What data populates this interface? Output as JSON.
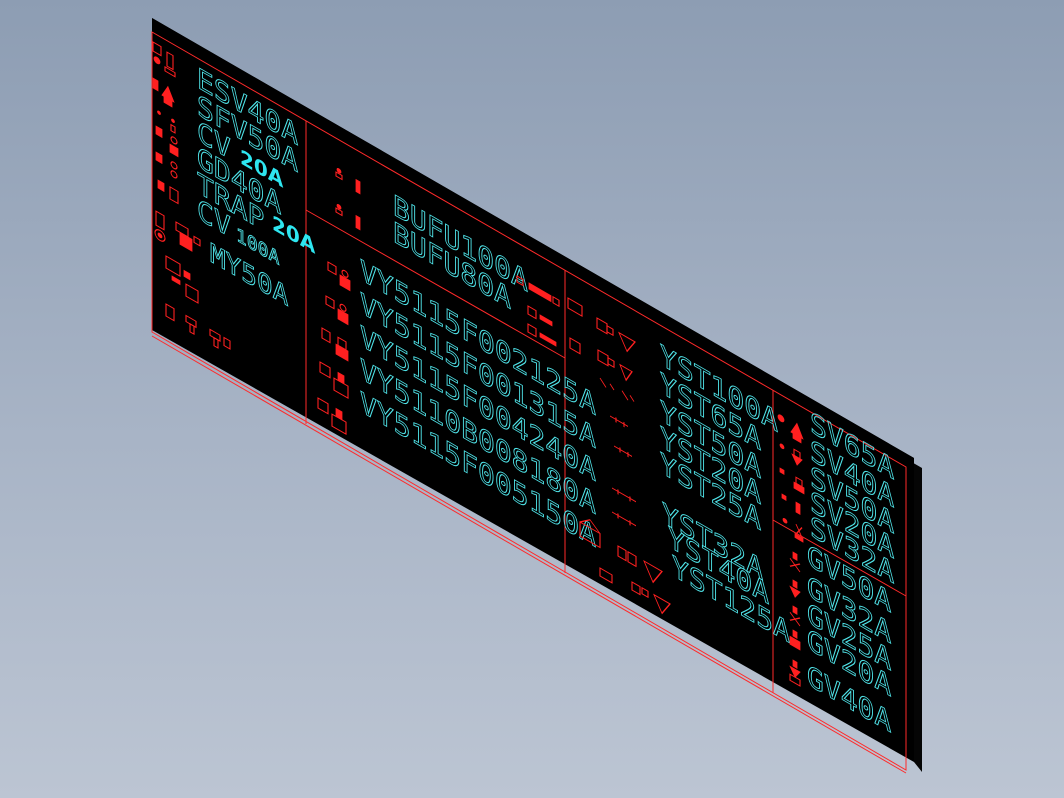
{
  "colors": {
    "board": "#000000",
    "board_edge": "#0a0a0a",
    "frame": "#ff2a2a",
    "label": "#4fe3e8",
    "symbol": "#ff2020",
    "background": "#a2afc2"
  },
  "panel1": {
    "labels": [
      "ESV40A",
      "SFV50A",
      "CV",
      "GD40A",
      "TRAP",
      "CV",
      "MY50A"
    ],
    "sub_labels": [
      "100A"
    ],
    "callouts": [
      "20A",
      "20A"
    ]
  },
  "panel2": {
    "labels": [
      "BUFU100A",
      "BUFU80A"
    ]
  },
  "panel3": {
    "labels": [
      "VY5115F002125A",
      "VY5115F001315A",
      "VY5115F004240A",
      "VY5110B008180A",
      "VY5115F005150A"
    ]
  },
  "panel4": {
    "labels": [
      "YST100A",
      "YST65A",
      "YST50A",
      "YST20A",
      "YST25A",
      "YST32A",
      "YST40A",
      "YST125A"
    ]
  },
  "panel5": {
    "labels": [
      "SV65A",
      "SV40A",
      "SV50A",
      "SV20A",
      "SV32A"
    ]
  },
  "panel6": {
    "labels": [
      "GV50A",
      "GV32A",
      "GV25A",
      "GV20A",
      "GV40A"
    ]
  },
  "symbols": {
    "panel1": "valve-symbol-icon",
    "panel2": "pump-symbol-icon",
    "panel3": "actuator-valve-icon",
    "panel4": "strainer-symbol-icon",
    "panel5": "solenoid-valve-icon",
    "panel6": "gate-valve-icon"
  }
}
